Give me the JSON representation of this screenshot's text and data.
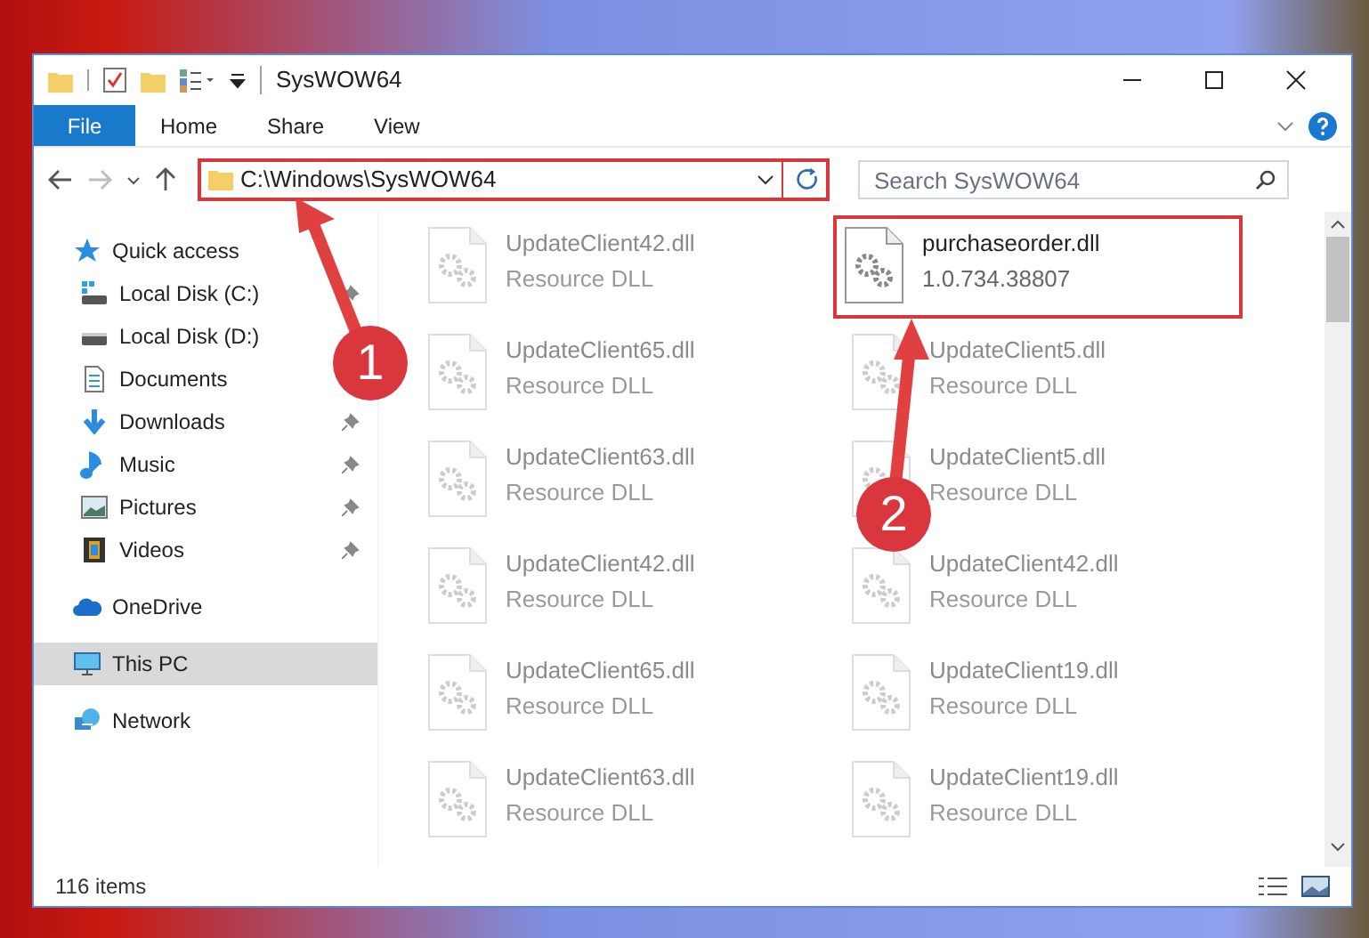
{
  "window": {
    "title": "SysWOW64"
  },
  "ribbon_tabs": [
    {
      "label": "File",
      "kind": "menu"
    },
    {
      "label": "Home",
      "kind": "tab"
    },
    {
      "label": "Share",
      "kind": "tab"
    },
    {
      "label": "View",
      "kind": "tab"
    }
  ],
  "address": {
    "path": "C:\\Windows\\SysWOW64"
  },
  "search": {
    "placeholder": "Search SysWOW64"
  },
  "sidebar": {
    "items": [
      {
        "label": "Quick access",
        "selected": false,
        "children": [
          {
            "label": "Local Disk (C:)",
            "pinned": true,
            "selected": false
          },
          {
            "label": "Local Disk (D:)",
            "pinned": false,
            "selected": false
          },
          {
            "label": "Documents",
            "pinned": false,
            "selected": false
          },
          {
            "label": "Downloads",
            "pinned": true,
            "selected": false
          },
          {
            "label": "Music",
            "pinned": true,
            "selected": false
          },
          {
            "label": "Pictures",
            "pinned": true,
            "selected": false
          },
          {
            "label": "Videos",
            "pinned": true,
            "selected": false
          }
        ]
      },
      {
        "label": "OneDrive",
        "selected": false
      },
      {
        "label": "This PC",
        "selected": true
      },
      {
        "label": "Network",
        "selected": false
      }
    ]
  },
  "files": [
    {
      "name": "UpdateClient42.dll",
      "detail": "Resource DLL",
      "blurred": true
    },
    {
      "name": "purchaseorder.dll",
      "detail": "1.0.734.38807",
      "blurred": false
    },
    {
      "name": "UpdateClient65.dll",
      "detail": "Resource DLL",
      "blurred": true
    },
    {
      "name": "UpdateClient5.dll",
      "detail": "Resource DLL",
      "blurred": true
    },
    {
      "name": "UpdateClient63.dll",
      "detail": "Resource DLL",
      "blurred": true
    },
    {
      "name": "UpdateClient5.dll",
      "detail": "Resource DLL",
      "blurred": true
    },
    {
      "name": "UpdateClient42.dll",
      "detail": "Resource DLL",
      "blurred": true
    },
    {
      "name": "UpdateClient42.dll",
      "detail": "Resource DLL",
      "blurred": true
    },
    {
      "name": "UpdateClient65.dll",
      "detail": "Resource DLL",
      "blurred": true
    },
    {
      "name": "UpdateClient19.dll",
      "detail": "Resource DLL",
      "blurred": true
    },
    {
      "name": "UpdateClient63.dll",
      "detail": "Resource DLL",
      "blurred": true
    },
    {
      "name": "UpdateClient19.dll",
      "detail": "Resource DLL",
      "blurred": true
    }
  ],
  "status_bar": {
    "item_count": "116 items"
  },
  "annotations": [
    {
      "label": "1"
    },
    {
      "label": "2"
    }
  ]
}
